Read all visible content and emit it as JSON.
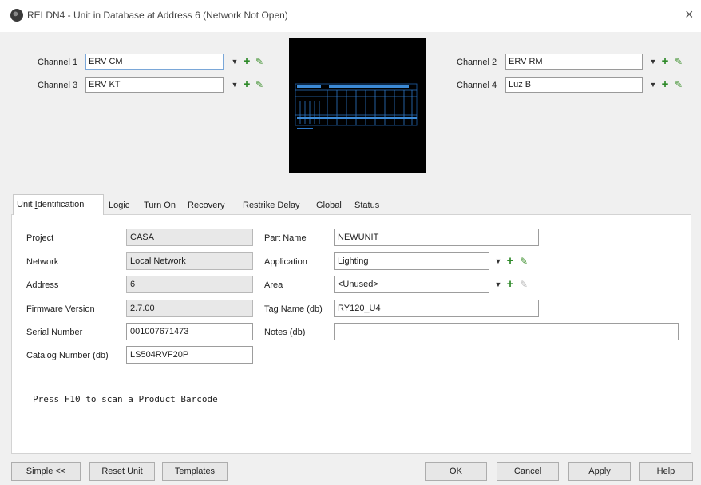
{
  "window": {
    "title": "RELDN4 - Unit in Database at Address 6 (Network Not Open)",
    "close_glyph": "×"
  },
  "channels": [
    {
      "label": "Channel 1",
      "value": "ERV CM"
    },
    {
      "label": "Channel 2",
      "value": "ERV RM"
    },
    {
      "label": "Channel 3",
      "value": "ERV KT"
    },
    {
      "label": "Channel 4",
      "value": "Luz B"
    }
  ],
  "glyphs": {
    "dropdown": "▼",
    "add": "+",
    "edit": "✎"
  },
  "tabs": [
    {
      "pre": "Unit ",
      "ul": "I",
      "post": "dentification"
    },
    {
      "pre": "",
      "ul": "L",
      "post": "ogic"
    },
    {
      "pre": "",
      "ul": "T",
      "post": "urn On"
    },
    {
      "pre": "",
      "ul": "R",
      "post": "ecovery"
    },
    {
      "pre": "Restrike ",
      "ul": "D",
      "post": "elay"
    },
    {
      "pre": "",
      "ul": "G",
      "post": "lobal"
    },
    {
      "pre": "Stat",
      "ul": "u",
      "post": "s"
    }
  ],
  "left_fields": [
    {
      "label": "Project",
      "value": "CASA"
    },
    {
      "label": "Network",
      "value": "Local Network"
    },
    {
      "label": "Address",
      "value": "6"
    },
    {
      "label": "Firmware Version",
      "value": "2.7.00"
    },
    {
      "label": "Serial Number",
      "value": "001007671473"
    },
    {
      "label": "Catalog Number (db)",
      "value": "LS504RVF20P"
    }
  ],
  "right_fields": [
    {
      "label": "Part Name",
      "value": "NEWUNIT"
    },
    {
      "label": "Application",
      "value": "Lighting"
    },
    {
      "label": "Area",
      "value": "<Unused>"
    },
    {
      "label": "Tag Name (db)",
      "value": "RY120_U4"
    },
    {
      "label": "Notes (db)",
      "value": ""
    }
  ],
  "hint": "Press F10 to scan a Product Barcode",
  "buttons": {
    "simple": {
      "ul": "S",
      "post": "imple <<"
    },
    "reset": "Reset Unit",
    "templates": "Templates",
    "ok": {
      "ul": "O",
      "post": "K"
    },
    "cancel": {
      "ul": "C",
      "post": "ancel"
    },
    "apply": {
      "ul": "A",
      "post": "pply"
    },
    "help": {
      "ul": "H",
      "post": "elp"
    }
  }
}
